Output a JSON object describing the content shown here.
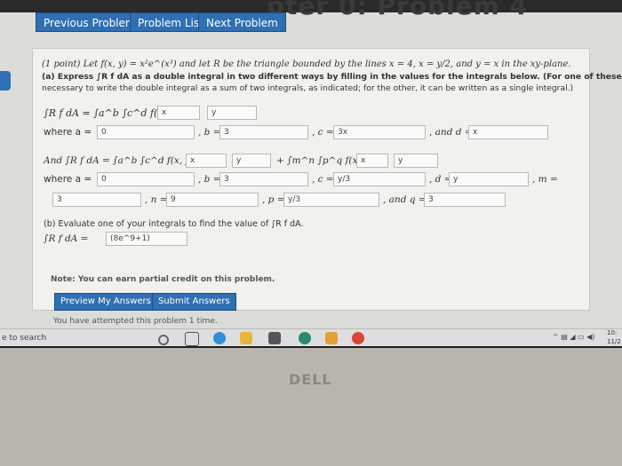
{
  "page_header": "pter 0: Problem 4",
  "nav": {
    "prev": "Previous Problem",
    "list": "Problem List",
    "next": "Next Problem"
  },
  "problem": {
    "statement": "(1 point) Let f(x, y) = x²e^(x³) and let R be the triangle bounded by the lines x = 4, x = y/2, and y = x in the xy-plane.",
    "part_a_line1": "(a) Express ∫R f dA as a double integral in two different ways by filling in the values for the integrals below. (For one of these it will be",
    "part_a_line2": "necessary to write the double integral as a sum of two integrals, as indicated; for the other, it can be written as a single integral.)",
    "first_integral_label": "∫R f dA = ∫a^b ∫c^d f(x, y) d",
    "where_a": "where a =",
    "b_eq": ", b =",
    "c_eq": ", c =",
    "and_d": ", and d =",
    "second_integral_label": "And ∫R f dA = ∫a^b ∫c^d f(x, y) d",
    "plus_integral": "+ ∫m^n ∫p^q f(x, y) d",
    "where_a2": "where a =",
    "b_eq2": ", b =",
    "c_eq2": ", c =",
    "d_eq2": ", d =",
    "m_eq": ", m =",
    "n_eq": ", n =",
    "p_eq": ", p =",
    "and_q": ", and q =",
    "part_b": "(b) Evaluate one of your integrals to find the value of ∫R f dA.",
    "part_b_label": "∫R f dA ="
  },
  "inputs": {
    "first_inner_d": "x",
    "first_outer_d": "y",
    "a1": "0",
    "b1": "3",
    "c1": "3x",
    "d1": "x",
    "second_inner_d": "x",
    "second_outer_d": "y",
    "plus_inner_d": "x",
    "plus_outer_d": "y",
    "a2": "0",
    "b2": "3",
    "c2": "y/3",
    "d2": "y",
    "m2": "3",
    "n2": "9",
    "p2": "y/3",
    "q2": "3",
    "answer_b": "(8e^9+1)"
  },
  "footer": {
    "note": "Note: You can earn partial credit on this problem.",
    "preview": "Preview My Answers",
    "submit": "Submit Answers",
    "attempts": "You have attempted this problem 1 time."
  },
  "taskbar": {
    "search": "e to search",
    "time": "10:",
    "date": "11/2"
  },
  "brand": "DELL",
  "colors": {
    "button": "#2f6fb3",
    "panel": "#f1f1ee"
  }
}
